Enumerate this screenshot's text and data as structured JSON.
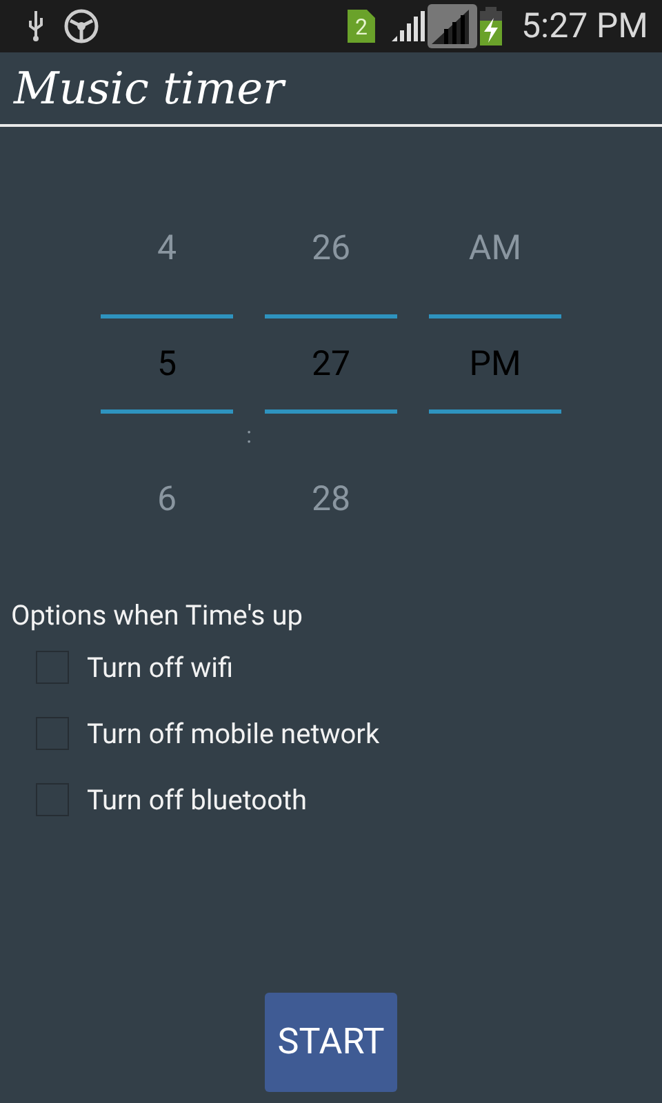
{
  "status_bar": {
    "sim_badge": "2",
    "time": "5:27 PM"
  },
  "title": "Music timer",
  "time_picker": {
    "separator": ":",
    "columns": [
      {
        "above": "4",
        "value": "5",
        "below": "6"
      },
      {
        "above": "26",
        "value": "27",
        "below": "28"
      },
      {
        "above": "AM",
        "value": "PM"
      }
    ]
  },
  "options": {
    "heading": "Options when Time's up",
    "items": [
      {
        "label": "Turn off wifi",
        "checked": false
      },
      {
        "label": "Turn off mobile network",
        "checked": false
      },
      {
        "label": "Turn off bluetooth",
        "checked": false
      }
    ]
  },
  "buttons": [
    {
      "label": "START"
    }
  ]
}
